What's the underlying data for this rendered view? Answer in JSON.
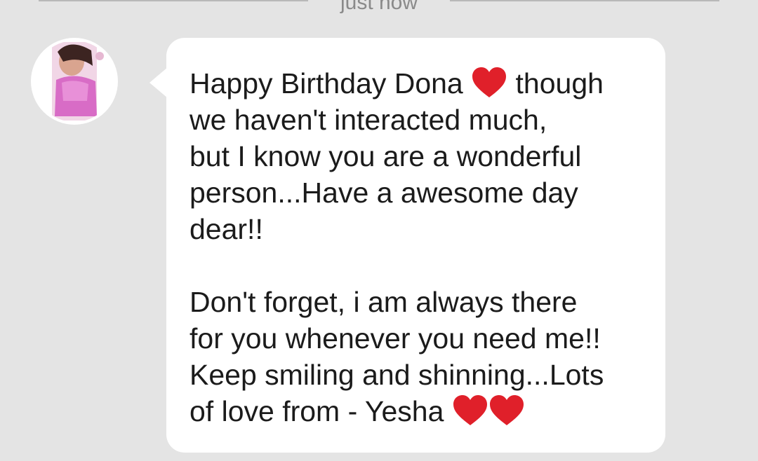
{
  "header": {
    "timestamp": "just now"
  },
  "message": {
    "paragraph1_before_heart": "Happy Birthday Dona ",
    "heart_icon": "red-heart-icon",
    "paragraph1_after_heart": " though\nwe haven't interacted much,\nbut I know you are a wonderful\nperson...Have a awesome day\ndear!!",
    "paragraph2": "Don't forget, i am always there\nfor you whenever you need me!!\nKeep smiling and shinning...Lots\nof love from - Yesha ",
    "heart_color": "#e0202a"
  },
  "colors": {
    "background": "#e4e4e4",
    "bubble": "#ffffff",
    "text": "#1b1b1b",
    "timestamp": "#8a8a8a"
  }
}
